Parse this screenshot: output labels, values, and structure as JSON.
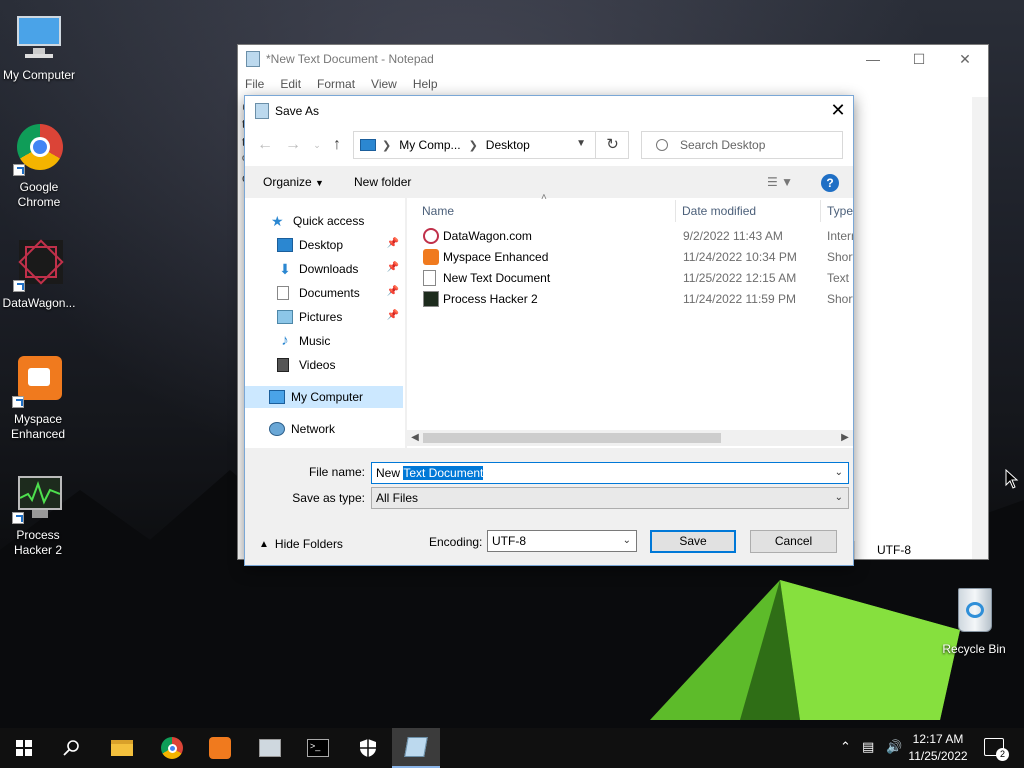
{
  "desktop": {
    "icons": [
      {
        "label": "My Computer",
        "icon": "monitor-icon"
      },
      {
        "label": "Google Chrome",
        "icon": "chrome-icon"
      },
      {
        "label": "DataWagon...",
        "icon": "datawagon-icon"
      },
      {
        "label": "Myspace Enhanced",
        "icon": "myspace-icon"
      },
      {
        "label": "Process Hacker 2",
        "icon": "process-hacker-icon"
      },
      {
        "label": "Recycle Bin",
        "icon": "recycle-bin-icon"
      }
    ]
  },
  "notepad": {
    "title": "*New Text Document - Notepad",
    "menu": [
      "File",
      "Edit",
      "Format",
      "View",
      "Help"
    ],
    "text_lines": [
      "@",
      "t",
      "t",
      "%",
      "c"
    ],
    "status_encoding": "UTF-8"
  },
  "dialog": {
    "title": "Save As",
    "address": {
      "crumb1": "My Comp...",
      "crumb2": "Desktop"
    },
    "search_placeholder": "Search Desktop",
    "toolbar": {
      "organize": "Organize",
      "new_folder": "New folder"
    },
    "nav": [
      {
        "label": "Quick access",
        "pinned": false
      },
      {
        "label": "Desktop",
        "pinned": true
      },
      {
        "label": "Downloads",
        "pinned": true
      },
      {
        "label": "Documents",
        "pinned": true
      },
      {
        "label": "Pictures",
        "pinned": true
      },
      {
        "label": "Music",
        "pinned": false
      },
      {
        "label": "Videos",
        "pinned": false
      },
      {
        "label": "My Computer",
        "pinned": false,
        "selected": true
      },
      {
        "label": "Network",
        "pinned": false
      }
    ],
    "columns": {
      "name": "Name",
      "date": "Date modified",
      "type": "Type"
    },
    "files": [
      {
        "name": "DataWagon.com",
        "date": "9/2/2022 11:43 AM",
        "type": "Interr"
      },
      {
        "name": "Myspace Enhanced",
        "date": "11/24/2022 10:34 PM",
        "type": "Short"
      },
      {
        "name": "New Text Document",
        "date": "11/25/2022 12:15 AM",
        "type": "Text D"
      },
      {
        "name": "Process Hacker 2",
        "date": "11/24/2022 11:59 PM",
        "type": "Short"
      }
    ],
    "filename_label": "File name:",
    "filename_value_prefix": "New ",
    "filename_value_selected": "Text Document",
    "savetype_label": "Save as type:",
    "savetype_value": "All Files",
    "hide_folders": "Hide Folders",
    "encoding_label": "Encoding:",
    "encoding_value": "UTF-8",
    "save_button": "Save",
    "cancel_button": "Cancel"
  },
  "taskbar": {
    "time": "12:17 AM",
    "date": "11/25/2022",
    "notification_count": "2",
    "apps": [
      "start-icon",
      "search-icon",
      "file-explorer-icon",
      "chrome-icon",
      "myspace-icon",
      "process-hacker-icon",
      "terminal-icon",
      "security-shield-icon",
      "notepad-icon"
    ]
  }
}
